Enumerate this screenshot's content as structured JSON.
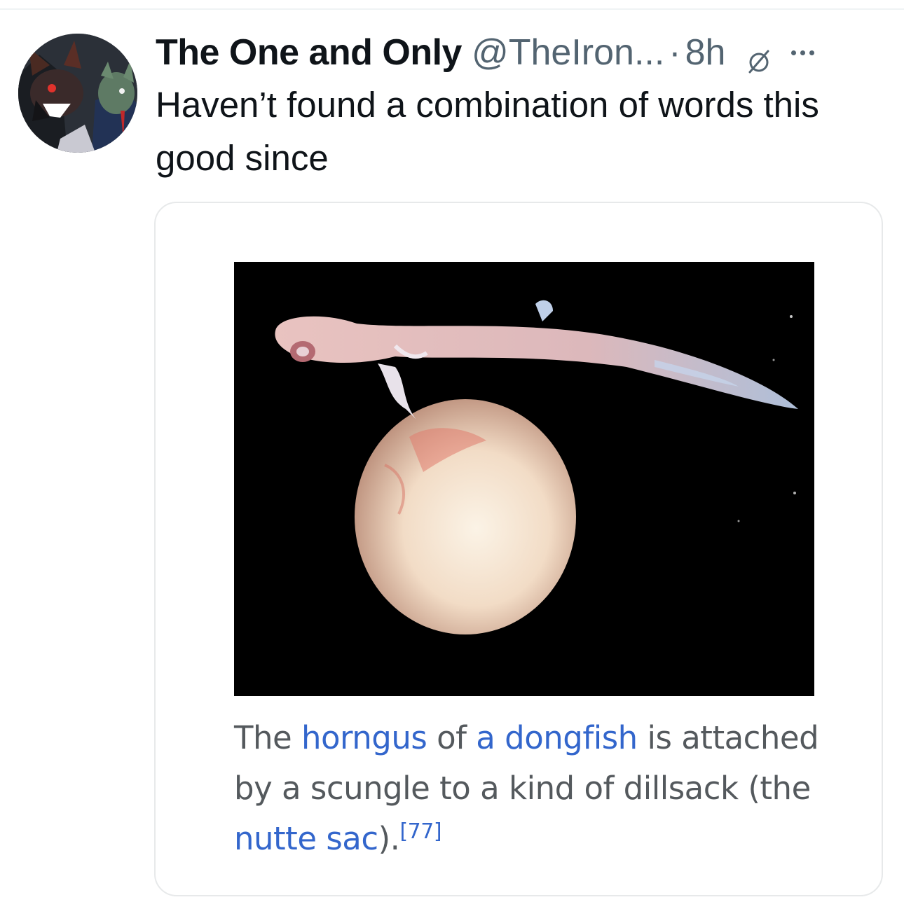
{
  "tweet": {
    "author": {
      "display_name": "The One and Only",
      "handle": "@TheIron...",
      "avatar_icon": "avatar-illustration"
    },
    "separator": "·",
    "time": "8h",
    "mute_icon": "mute-icon",
    "more_icon": "more-options-icon",
    "text": "Haven’t found a combination of words this good since"
  },
  "media": {
    "image_icon": "embryo-photo",
    "caption": {
      "t1": "The ",
      "l1": "horngus",
      "t2": " of ",
      "l2": "a dongfish",
      "t3": " is attached by a scungle to a kind of dillsack (the ",
      "l3": "nutte sac",
      "t4": ").",
      "ref": "[77]"
    }
  },
  "colors": {
    "text": "#0f1419",
    "secondary": "#536471",
    "link": "#3366cc",
    "caption": "#54595d",
    "border": "#e7e9ea"
  }
}
